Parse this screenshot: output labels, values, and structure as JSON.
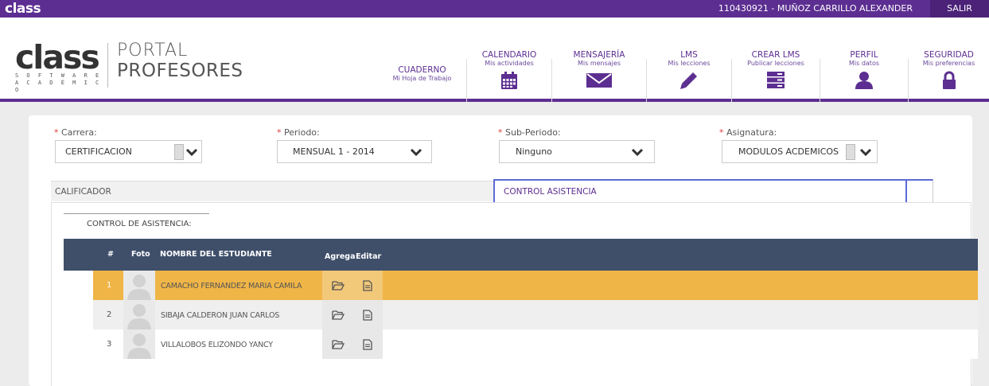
{
  "topbar": {
    "brand": "class",
    "user": "110430921 - MUÑOZ CARRILLO ALEXANDER",
    "logout_label": "SALIR"
  },
  "header": {
    "logo_big": "class",
    "logo_line1": "S O F T W A R E",
    "logo_line2": "A C A D É M I C O",
    "portal_line1": "PORTAL",
    "portal_line2": "PROFESORES",
    "nav": [
      {
        "title": "CUADERNO",
        "sub": "Mi Hoja de Trabajo",
        "icon": "none",
        "active": true
      },
      {
        "title": "CALENDARIO",
        "sub": "Mis actividades",
        "icon": "calendar-icon"
      },
      {
        "title": "MENSAJERÍA",
        "sub": "Mis mensajes",
        "icon": "envelope-icon"
      },
      {
        "title": "LMS",
        "sub": "Mis lecciones",
        "icon": "pencil-icon"
      },
      {
        "title": "CREAR LMS",
        "sub": "Publicar lecciones",
        "icon": "server-icon"
      },
      {
        "title": "PERFIL",
        "sub": "Mis datos",
        "icon": "user-icon"
      },
      {
        "title": "SEGURIDAD",
        "sub": "Mis preferencias",
        "icon": "lock-icon"
      }
    ]
  },
  "filters": {
    "carrera": {
      "label": "Carrera:",
      "value": "CERTIFICACION"
    },
    "periodo": {
      "label": "Periodo:",
      "value": "MENSUAL 1 - 2014"
    },
    "subperiodo": {
      "label": "Sub-Periodo:",
      "value": "Ninguno"
    },
    "asignatura": {
      "label": "Asignatura:",
      "value": "MODULOS ACDEMICOS"
    },
    "required_mark": "*"
  },
  "tabs": {
    "calificador": "CALIFICADOR",
    "control": "CONTROL ASISTENCIA"
  },
  "section": {
    "title": "CONTROL DE ASISTENCIA:"
  },
  "table": {
    "headers": {
      "num": "#",
      "foto": "Foto",
      "nombre": "NOMBRE DEL ESTUDIANTE",
      "agrega": "Agrega",
      "editar": "Editar"
    },
    "rows": [
      {
        "num": "1",
        "name": "CAMACHO FERNANDEZ MARIA CAMILA",
        "highlighted": true
      },
      {
        "num": "2",
        "name": "SIBAJA CALDERON JUAN CARLOS",
        "highlighted": false
      },
      {
        "num": "3",
        "name": "VILLALOBOS ELIZONDO YANCY",
        "highlighted": false
      }
    ]
  },
  "colors": {
    "brand_purple": "#5c2e91",
    "table_header": "#3f4f6a",
    "row_highlight": "#f0b547",
    "row_alt": "#efefef"
  }
}
